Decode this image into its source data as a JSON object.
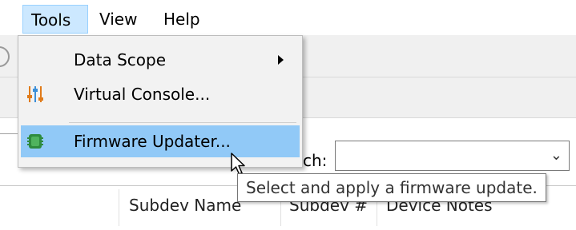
{
  "menubar": {
    "items": [
      {
        "label": "Tools"
      },
      {
        "label": "View"
      },
      {
        "label": "Help"
      }
    ]
  },
  "dropdown": {
    "items": [
      {
        "label": "Data Scope",
        "has_submenu": true
      },
      {
        "label": "Virtual Console...",
        "icon": "sliders-icon"
      },
      {
        "label": "Firmware Updater...",
        "icon": "chip-icon",
        "highlighted": true
      }
    ]
  },
  "tooltip": {
    "text": "Select and apply a firmware update."
  },
  "search": {
    "label_fragment": "ch:",
    "value": ""
  },
  "table": {
    "columns": [
      "Subdev Name",
      "Subdev #",
      "Device Notes"
    ]
  },
  "colors": {
    "menu_highlight": "#91c9f7",
    "active_menubar": "#cce8ff",
    "chip_green": "#2e8b3e"
  }
}
